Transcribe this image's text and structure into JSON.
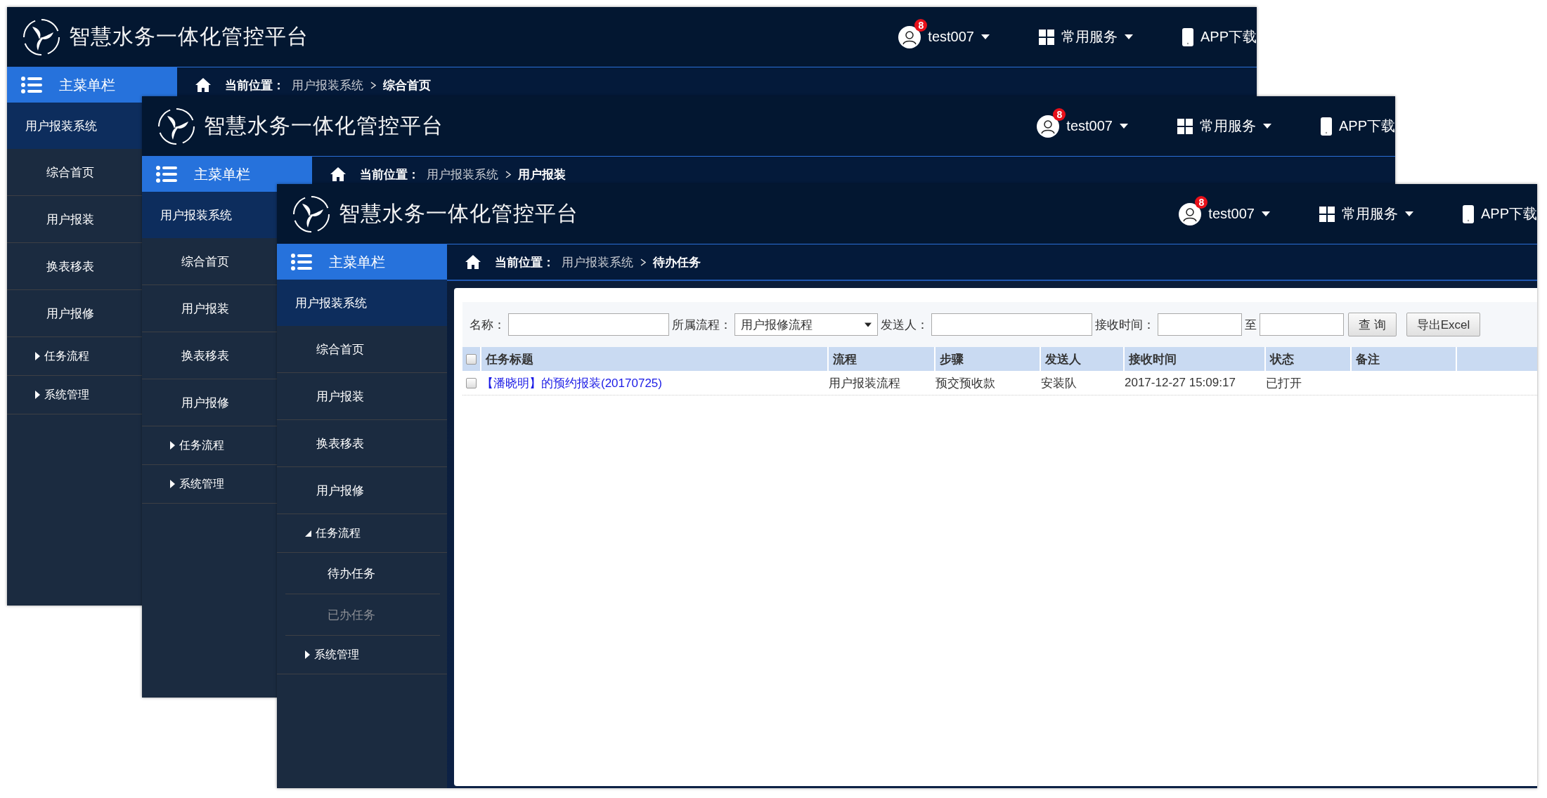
{
  "windows": [
    {
      "header": {
        "title": "智慧水务一体化管控平台",
        "user": {
          "name": "test007",
          "badge": "8"
        },
        "services": "常用服务",
        "app": "APP下载"
      },
      "sidebar": {
        "title": "主菜单栏",
        "items": [
          {
            "kind": "section",
            "label": "用户报装系统"
          },
          {
            "kind": "link",
            "label": "综合首页"
          },
          {
            "kind": "link",
            "label": "用户报装"
          },
          {
            "kind": "link",
            "label": "换表移表"
          },
          {
            "kind": "link",
            "label": "用户报修"
          },
          {
            "kind": "group",
            "label": "任务流程",
            "expanded": false
          },
          {
            "kind": "group",
            "label": "系统管理",
            "expanded": false
          }
        ]
      },
      "breadcrumb": {
        "label": "当前位置：",
        "path": "用户报装系统",
        "current": "综合首页"
      }
    },
    {
      "header": {
        "title": "智慧水务一体化管控平台",
        "user": {
          "name": "test007",
          "badge": "8"
        },
        "services": "常用服务",
        "app": "APP下载"
      },
      "sidebar": {
        "title": "主菜单栏",
        "items": [
          {
            "kind": "section",
            "label": "用户报装系统"
          },
          {
            "kind": "link",
            "label": "综合首页"
          },
          {
            "kind": "link",
            "label": "用户报装"
          },
          {
            "kind": "link",
            "label": "换表移表"
          },
          {
            "kind": "link",
            "label": "用户报修"
          },
          {
            "kind": "group",
            "label": "任务流程",
            "expanded": false
          },
          {
            "kind": "group",
            "label": "系统管理",
            "expanded": false
          }
        ]
      },
      "breadcrumb": {
        "label": "当前位置：",
        "path": "用户报装系统",
        "current": "用户报装"
      }
    },
    {
      "header": {
        "title": "智慧水务一体化管控平台",
        "user": {
          "name": "test007",
          "badge": "8"
        },
        "services": "常用服务",
        "app": "APP下载"
      },
      "sidebar": {
        "title": "主菜单栏",
        "items": [
          {
            "kind": "section",
            "label": "用户报装系统"
          },
          {
            "kind": "link",
            "label": "综合首页"
          },
          {
            "kind": "link",
            "label": "用户报装"
          },
          {
            "kind": "link",
            "label": "换表移表"
          },
          {
            "kind": "link",
            "label": "用户报修"
          },
          {
            "kind": "group",
            "label": "任务流程",
            "expanded": true,
            "children": [
              {
                "label": "待办任务",
                "selected": true
              },
              {
                "label": "已办任务",
                "selected": false
              }
            ]
          },
          {
            "kind": "group",
            "label": "系统管理",
            "expanded": false
          }
        ]
      },
      "breadcrumb": {
        "label": "当前位置：",
        "path": "用户报装系统",
        "current": "待办任务"
      },
      "task_panel": {
        "filters": [
          {
            "kind": "input",
            "label": "名称："
          },
          {
            "kind": "select",
            "label": "所属流程：",
            "value": "用户报修流程"
          },
          {
            "kind": "input",
            "label": "发送人："
          },
          {
            "kind": "date",
            "label": "接收时间："
          },
          {
            "kind": "date",
            "label": "至"
          }
        ],
        "buttons": [
          "查 询",
          "导出Excel"
        ],
        "table": {
          "header_checked": false,
          "columns": [
            "任务标题",
            "流程",
            "步骤",
            "发送人",
            "接收时间",
            "状态",
            "备注"
          ],
          "rows": [
            {
              "checked": false,
              "cells": [
                "【潘晓明】的预约报装(20170725)",
                "用户报装流程",
                "预交预收款",
                "安装队",
                "2017-12-27 15:09:17",
                "已打开"
              ]
            }
          ]
        }
      }
    }
  ]
}
